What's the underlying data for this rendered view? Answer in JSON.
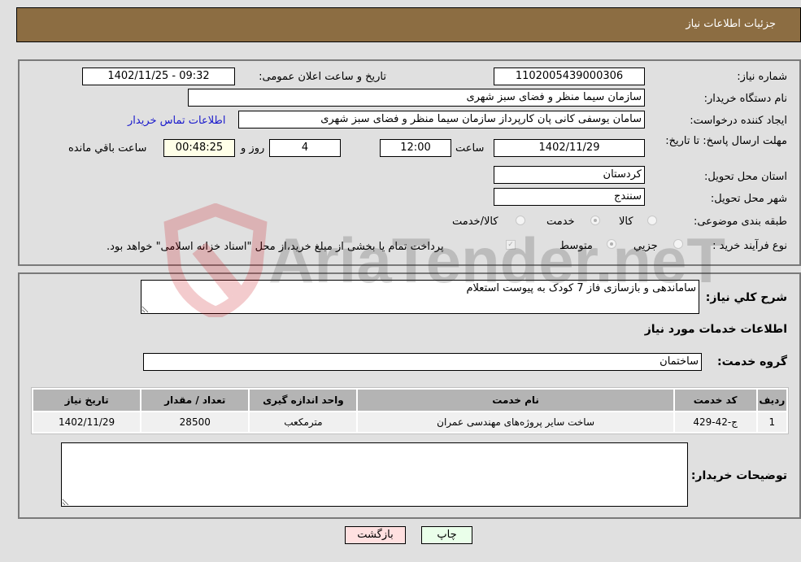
{
  "header": {
    "title": "جزئیات اطلاعات نیاز"
  },
  "form": {
    "need_number_label": "شماره نیاز:",
    "need_number": "1102005439000306",
    "announce_label": "تاریخ و ساعت اعلان عمومی:",
    "announce_value": "1402/11/25 - 09:32",
    "buyer_org_label": "نام دستگاه خریدار:",
    "buyer_org": "سازمان سیما  منظر و فضای سبز شهری",
    "creator_label": "ایجاد کننده درخواست:",
    "creator": "سامان یوسفی کانی پان کارپرداز سازمان سیما  منظر و فضای سبز شهری",
    "contact_link": "اطلاعات تماس خریدار",
    "deadline_label": "مهلت ارسال پاسخ: تا تاریخ:",
    "deadline_date": "1402/11/29",
    "time_label": "ساعت",
    "deadline_time": "12:00",
    "days_value": "4",
    "days_label": "روز و",
    "remaining_time": "00:48:25",
    "remaining_label": "ساعت باقي مانده",
    "province_label": "استان محل تحویل:",
    "province": "کردستان",
    "city_label": "شهر محل تحویل:",
    "city": "سنندج",
    "category_label": "طبقه بندی موضوعی:",
    "category_options": [
      {
        "label": "کالا",
        "checked": false
      },
      {
        "label": "خدمت",
        "checked": true
      },
      {
        "label": "کالا/خدمت",
        "checked": false
      }
    ],
    "process_label": "نوع فرآیند خرید :",
    "process_options": [
      {
        "label": "جزیي",
        "checked": false
      },
      {
        "label": "متوسط",
        "checked": true
      }
    ],
    "treasury_note": "پرداخت تمام یا بخشی از مبلغ خرید،از محل \"اسناد خزانه اسلامی\" خواهد بود.",
    "treasury_checked": true
  },
  "details": {
    "description_label": "شرح کلي نیاز:",
    "description": "ساماندهی و بازسازی فاز 7 کودک به پیوست استعلام",
    "services_heading": "اطلاعات خدمات مورد نیاز",
    "service_group_label": "گروه خدمت:",
    "service_group": "ساختمان",
    "table": {
      "headers": [
        "ردیف",
        "کد خدمت",
        "نام خدمت",
        "واحد اندازه گیری",
        "تعداد / مقدار",
        "تاریخ نیاز"
      ],
      "rows": [
        [
          "1",
          "ج-42-429",
          "ساخت سایر پروژه‌های مهندسی عمران",
          "مترمکعب",
          "28500",
          "1402/11/29"
        ]
      ]
    },
    "buyer_notes_label": "توضیحات خریدار:",
    "buyer_notes": ""
  },
  "buttons": {
    "print": "چاپ",
    "back": "بازگشت"
  },
  "watermark": {
    "text": "AriaTender.neT"
  }
}
